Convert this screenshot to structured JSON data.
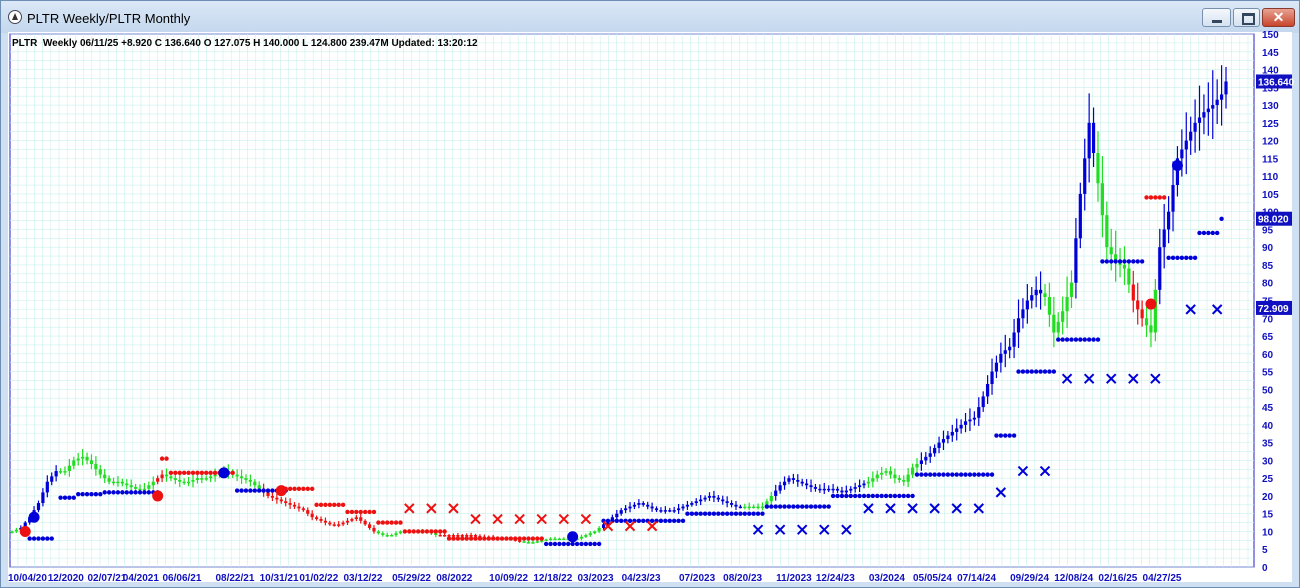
{
  "window": {
    "title": "PLTR  Weekly/PLTR  Monthly",
    "minimize_label": "",
    "maximize_label": "",
    "close_label": "✕"
  },
  "header": {
    "info_line": "PLTR  Weekly 06/11/25 +8.920 C 136.640 O 127.075 H 140.000 L 124.800 239.47M Updated: 13:20:12"
  },
  "chart_data": {
    "type": "candlestick",
    "symbol": "PLTR",
    "timeframe": "Weekly",
    "ylim": [
      0,
      150
    ],
    "y_ticks": [
      0,
      5,
      10,
      15,
      20,
      25,
      30,
      35,
      40,
      45,
      50,
      55,
      60,
      65,
      70,
      75,
      80,
      85,
      90,
      95,
      100,
      105,
      110,
      115,
      120,
      125,
      130,
      135,
      140,
      145,
      150
    ],
    "x_tick_labels": [
      "10/04/20",
      "12/2020",
      "02/07/21",
      "04/2021",
      "06/06/21",
      "08/22/21",
      "10/31/21",
      "01/02/22",
      "03/12/22",
      "05/29/22",
      "08/2022",
      "10/09/22",
      "12/18/22",
      "03/2023",
      "04/23/23",
      "07/2023",
      "08/20/23",
      "11/2023",
      "12/24/23",
      "03/2024",
      "05/05/24",
      "07/14/24",
      "09/29/24",
      "12/08/24",
      "02/16/25",
      "04/27/25"
    ],
    "x_tick_weeks": [
      0,
      9,
      18,
      26,
      35,
      47,
      57,
      66,
      76,
      87,
      97,
      109,
      119,
      129,
      139,
      152,
      162,
      174,
      183,
      195,
      205,
      215,
      227,
      237,
      247,
      257
    ],
    "price_labels": [
      {
        "value": "136.640",
        "y": 136.64,
        "color": "#1010c0"
      },
      {
        "value": "98.020",
        "y": 98.02,
        "color": "#1010c0"
      },
      {
        "value": "72.909",
        "y": 72.909,
        "color": "#1010c0"
      }
    ],
    "weekly_close_anchors": [
      [
        0,
        10
      ],
      [
        2,
        11
      ],
      [
        4,
        14
      ],
      [
        6,
        18
      ],
      [
        8,
        24
      ],
      [
        10,
        27
      ],
      [
        12,
        27
      ],
      [
        14,
        30
      ],
      [
        16,
        31
      ],
      [
        18,
        29
      ],
      [
        20,
        26
      ],
      [
        22,
        24
      ],
      [
        24,
        24
      ],
      [
        26,
        23
      ],
      [
        28,
        22
      ],
      [
        30,
        22
      ],
      [
        32,
        24
      ],
      [
        34,
        26
      ],
      [
        36,
        25
      ],
      [
        38,
        24
      ],
      [
        40,
        24
      ],
      [
        42,
        25
      ],
      [
        44,
        25
      ],
      [
        46,
        26
      ],
      [
        48,
        27
      ],
      [
        50,
        26
      ],
      [
        52,
        25
      ],
      [
        54,
        24
      ],
      [
        56,
        22
      ],
      [
        58,
        20
      ],
      [
        60,
        19
      ],
      [
        62,
        18
      ],
      [
        64,
        17
      ],
      [
        66,
        16
      ],
      [
        68,
        14
      ],
      [
        70,
        13
      ],
      [
        72,
        12
      ],
      [
        74,
        12
      ],
      [
        76,
        13
      ],
      [
        78,
        14
      ],
      [
        80,
        12
      ],
      [
        82,
        10
      ],
      [
        84,
        9
      ],
      [
        86,
        9
      ],
      [
        88,
        10
      ],
      [
        90,
        10
      ],
      [
        92,
        10
      ],
      [
        94,
        10
      ],
      [
        96,
        9
      ],
      [
        98,
        9
      ],
      [
        100,
        9
      ],
      [
        102,
        9
      ],
      [
        104,
        9
      ],
      [
        106,
        8.5
      ],
      [
        108,
        8.5
      ],
      [
        110,
        8
      ],
      [
        112,
        8
      ],
      [
        114,
        7.5
      ],
      [
        116,
        7
      ],
      [
        118,
        7
      ],
      [
        120,
        7.5
      ],
      [
        122,
        8
      ],
      [
        124,
        8
      ],
      [
        126,
        8
      ],
      [
        128,
        8
      ],
      [
        130,
        9
      ],
      [
        132,
        10
      ],
      [
        134,
        12
      ],
      [
        136,
        14
      ],
      [
        138,
        16
      ],
      [
        140,
        17
      ],
      [
        142,
        18
      ],
      [
        144,
        17
      ],
      [
        146,
        16
      ],
      [
        148,
        16
      ],
      [
        150,
        16
      ],
      [
        152,
        17
      ],
      [
        154,
        18
      ],
      [
        156,
        19
      ],
      [
        158,
        20
      ],
      [
        160,
        19
      ],
      [
        162,
        18
      ],
      [
        164,
        17
      ],
      [
        166,
        17
      ],
      [
        168,
        17
      ],
      [
        170,
        17
      ],
      [
        172,
        20
      ],
      [
        174,
        23
      ],
      [
        176,
        25
      ],
      [
        178,
        24
      ],
      [
        180,
        23
      ],
      [
        182,
        22
      ],
      [
        184,
        22
      ],
      [
        186,
        22
      ],
      [
        188,
        21
      ],
      [
        190,
        22
      ],
      [
        192,
        23
      ],
      [
        194,
        24
      ],
      [
        196,
        26
      ],
      [
        198,
        27
      ],
      [
        200,
        25
      ],
      [
        202,
        24
      ],
      [
        204,
        28
      ],
      [
        206,
        30
      ],
      [
        208,
        32
      ],
      [
        210,
        35
      ],
      [
        212,
        37
      ],
      [
        214,
        39
      ],
      [
        216,
        41
      ],
      [
        218,
        42
      ],
      [
        220,
        48
      ],
      [
        222,
        55
      ],
      [
        224,
        60
      ],
      [
        226,
        62
      ],
      [
        228,
        70
      ],
      [
        230,
        75
      ],
      [
        232,
        78
      ],
      [
        234,
        76
      ],
      [
        236,
        66
      ],
      [
        238,
        72
      ],
      [
        240,
        80
      ],
      [
        242,
        105
      ],
      [
        244,
        125
      ],
      [
        246,
        108
      ],
      [
        248,
        90
      ],
      [
        250,
        86
      ],
      [
        252,
        84
      ],
      [
        254,
        75
      ],
      [
        256,
        70
      ],
      [
        258,
        66
      ],
      [
        260,
        90
      ],
      [
        262,
        100
      ],
      [
        264,
        115
      ],
      [
        266,
        120
      ],
      [
        268,
        125
      ],
      [
        270,
        128
      ],
      [
        272,
        130
      ],
      [
        274,
        133
      ],
      [
        275,
        136.64
      ]
    ],
    "weekly_color_segments": [
      {
        "from": 0,
        "to": 1,
        "color": "green"
      },
      {
        "from": 2,
        "to": 10,
        "color": "blue"
      },
      {
        "from": 11,
        "to": 32,
        "color": "green"
      },
      {
        "from": 33,
        "to": 34,
        "color": "red"
      },
      {
        "from": 35,
        "to": 56,
        "color": "green"
      },
      {
        "from": 57,
        "to": 82,
        "color": "red"
      },
      {
        "from": 83,
        "to": 96,
        "color": "green"
      },
      {
        "from": 97,
        "to": 115,
        "color": "red"
      },
      {
        "from": 116,
        "to": 133,
        "color": "green"
      },
      {
        "from": 134,
        "to": 165,
        "color": "blue"
      },
      {
        "from": 166,
        "to": 172,
        "color": "green"
      },
      {
        "from": 173,
        "to": 193,
        "color": "blue"
      },
      {
        "from": 194,
        "to": 205,
        "color": "green"
      },
      {
        "from": 206,
        "to": 233,
        "color": "blue"
      },
      {
        "from": 234,
        "to": 240,
        "color": "green"
      },
      {
        "from": 241,
        "to": 245,
        "color": "blue"
      },
      {
        "from": 246,
        "to": 253,
        "color": "green"
      },
      {
        "from": 254,
        "to": 256,
        "color": "red"
      },
      {
        "from": 257,
        "to": 259,
        "color": "green"
      },
      {
        "from": 260,
        "to": 275,
        "color": "blue"
      }
    ],
    "stop_runs": [
      {
        "from": 4,
        "to": 9,
        "y": 8,
        "color": "blue"
      },
      {
        "from": 11,
        "to": 14,
        "y": 19.5,
        "color": "blue"
      },
      {
        "from": 15,
        "to": 20,
        "y": 20.5,
        "color": "blue"
      },
      {
        "from": 21,
        "to": 33,
        "y": 21,
        "color": "blue"
      },
      {
        "from": 34,
        "to": 35,
        "y": 30.5,
        "color": "red"
      },
      {
        "from": 36,
        "to": 44,
        "y": 26.5,
        "color": "red"
      },
      {
        "from": 45,
        "to": 50,
        "y": 26.5,
        "color": "red"
      },
      {
        "from": 51,
        "to": 62,
        "y": 21.5,
        "color": "blue"
      },
      {
        "from": 62,
        "to": 68,
        "y": 22,
        "color": "red"
      },
      {
        "from": 69,
        "to": 75,
        "y": 17.5,
        "color": "red"
      },
      {
        "from": 76,
        "to": 82,
        "y": 15.5,
        "color": "red"
      },
      {
        "from": 83,
        "to": 88,
        "y": 12.5,
        "color": "red"
      },
      {
        "from": 89,
        "to": 98,
        "y": 10,
        "color": "red"
      },
      {
        "from": 99,
        "to": 120,
        "y": 8,
        "color": "red"
      },
      {
        "from": 121,
        "to": 133,
        "y": 6.5,
        "color": "blue"
      },
      {
        "from": 134,
        "to": 152,
        "y": 13,
        "color": "blue"
      },
      {
        "from": 153,
        "to": 170,
        "y": 15,
        "color": "blue"
      },
      {
        "from": 171,
        "to": 185,
        "y": 17,
        "color": "blue"
      },
      {
        "from": 186,
        "to": 204,
        "y": 20,
        "color": "blue"
      },
      {
        "from": 205,
        "to": 222,
        "y": 26,
        "color": "blue"
      },
      {
        "from": 223,
        "to": 227,
        "y": 37,
        "color": "blue"
      },
      {
        "from": 228,
        "to": 236,
        "y": 55,
        "color": "blue"
      },
      {
        "from": 237,
        "to": 246,
        "y": 64,
        "color": "blue"
      },
      {
        "from": 247,
        "to": 256,
        "y": 86,
        "color": "blue"
      },
      {
        "from": 257,
        "to": 261,
        "y": 104,
        "color": "red"
      },
      {
        "from": 262,
        "to": 268,
        "y": 87,
        "color": "blue"
      },
      {
        "from": 269,
        "to": 273,
        "y": 94,
        "color": "blue"
      },
      {
        "from": 274,
        "to": 274,
        "y": 98,
        "color": "blue"
      }
    ],
    "signal_dots": [
      {
        "week": 3,
        "y": 10,
        "color": "red"
      },
      {
        "week": 5,
        "y": 14,
        "color": "blue"
      },
      {
        "week": 33,
        "y": 20,
        "color": "red"
      },
      {
        "week": 48,
        "y": 26.5,
        "color": "blue"
      },
      {
        "week": 61,
        "y": 21.5,
        "color": "red"
      },
      {
        "week": 127,
        "y": 8.5,
        "color": "blue"
      },
      {
        "week": 258,
        "y": 74,
        "color": "red"
      },
      {
        "week": 264,
        "y": 113,
        "color": "blue"
      }
    ],
    "x_markers": [
      {
        "week": 90,
        "y": 16.5,
        "color": "red"
      },
      {
        "week": 95,
        "y": 16.5,
        "color": "red"
      },
      {
        "week": 100,
        "y": 16.5,
        "color": "red"
      },
      {
        "week": 105,
        "y": 13.5,
        "color": "red"
      },
      {
        "week": 110,
        "y": 13.5,
        "color": "red"
      },
      {
        "week": 115,
        "y": 13.5,
        "color": "red"
      },
      {
        "week": 120,
        "y": 13.5,
        "color": "red"
      },
      {
        "week": 125,
        "y": 13.5,
        "color": "red"
      },
      {
        "week": 130,
        "y": 13.5,
        "color": "red"
      },
      {
        "week": 135,
        "y": 11.5,
        "color": "red"
      },
      {
        "week": 140,
        "y": 11.5,
        "color": "red"
      },
      {
        "week": 145,
        "y": 11.5,
        "color": "red"
      },
      {
        "week": 169,
        "y": 10.5,
        "color": "blue"
      },
      {
        "week": 174,
        "y": 10.5,
        "color": "blue"
      },
      {
        "week": 179,
        "y": 10.5,
        "color": "blue"
      },
      {
        "week": 184,
        "y": 10.5,
        "color": "blue"
      },
      {
        "week": 189,
        "y": 10.5,
        "color": "blue"
      },
      {
        "week": 194,
        "y": 16.5,
        "color": "blue"
      },
      {
        "week": 199,
        "y": 16.5,
        "color": "blue"
      },
      {
        "week": 204,
        "y": 16.5,
        "color": "blue"
      },
      {
        "week": 209,
        "y": 16.5,
        "color": "blue"
      },
      {
        "week": 214,
        "y": 16.5,
        "color": "blue"
      },
      {
        "week": 219,
        "y": 16.5,
        "color": "blue"
      },
      {
        "week": 224,
        "y": 21,
        "color": "blue"
      },
      {
        "week": 229,
        "y": 27,
        "color": "blue"
      },
      {
        "week": 234,
        "y": 27,
        "color": "blue"
      },
      {
        "week": 239,
        "y": 53,
        "color": "blue"
      },
      {
        "week": 244,
        "y": 53,
        "color": "blue"
      },
      {
        "week": 249,
        "y": 53,
        "color": "blue"
      },
      {
        "week": 254,
        "y": 53,
        "color": "blue"
      },
      {
        "week": 259,
        "y": 53,
        "color": "blue"
      },
      {
        "week": 267,
        "y": 72.5,
        "color": "blue"
      },
      {
        "week": 273,
        "y": 72.5,
        "color": "blue"
      }
    ],
    "grid": true
  }
}
